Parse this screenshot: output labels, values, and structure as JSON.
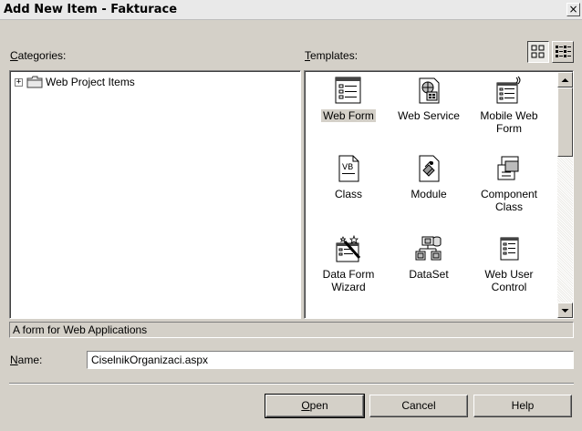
{
  "window": {
    "title": "Add New Item - Fakturace",
    "close_glyph": "×"
  },
  "categories": {
    "label_accel": "C",
    "label_rest": "ategories:",
    "tree": [
      {
        "expander": "+",
        "label": "Web Project Items"
      }
    ]
  },
  "templates": {
    "label_accel": "T",
    "label_rest": "emplates:",
    "view_modes": [
      "large-icons",
      "small-icons"
    ],
    "items": [
      {
        "label": "Web Form",
        "icon": "web-form-icon",
        "selected": true
      },
      {
        "label": "Web Service",
        "icon": "web-service-icon"
      },
      {
        "label": "Mobile Web Form",
        "icon": "mobile-web-form-icon"
      },
      {
        "label": "Class",
        "icon": "class-icon"
      },
      {
        "label": "Module",
        "icon": "module-icon"
      },
      {
        "label": "Component Class",
        "icon": "component-class-icon"
      },
      {
        "label": "Data Form Wizard",
        "icon": "data-form-wizard-icon"
      },
      {
        "label": "DataSet",
        "icon": "dataset-icon"
      },
      {
        "label": "Web User Control",
        "icon": "web-user-control-icon"
      }
    ]
  },
  "description": "A form for Web Applications",
  "name_field": {
    "label_accel": "N",
    "label_rest": "ame:",
    "value": "CiselnikOrganizaci.aspx"
  },
  "buttons": {
    "open_accel": "O",
    "open_rest": "pen",
    "cancel": "Cancel",
    "help": "Help"
  }
}
